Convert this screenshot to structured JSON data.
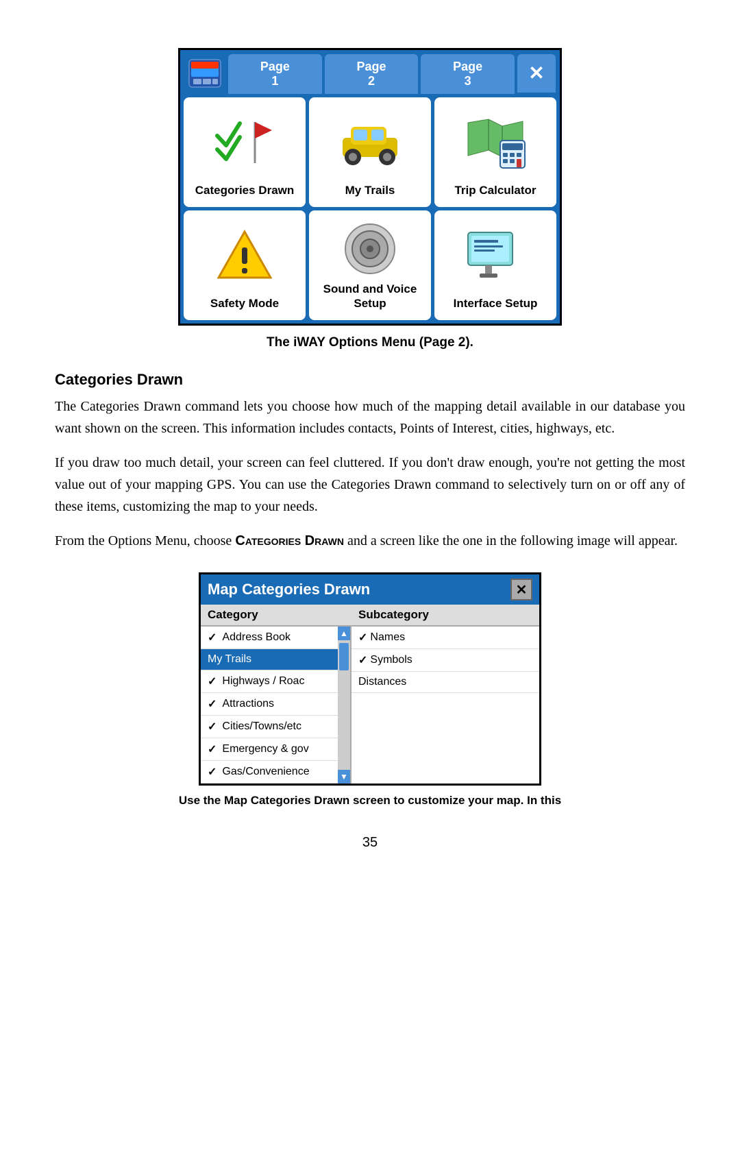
{
  "menu": {
    "tabs": [
      {
        "label": "Page\n1",
        "id": "page1"
      },
      {
        "label": "Page\n2",
        "id": "page2"
      },
      {
        "label": "Page\n3",
        "id": "page3"
      }
    ],
    "close_label": "✕",
    "cells": [
      {
        "id": "categories-drawn",
        "label": "Categories\nDrawn",
        "icon": "check-flag"
      },
      {
        "id": "my-trails",
        "label": "My Trails",
        "icon": "car"
      },
      {
        "id": "trip-calculator",
        "label": "Trip Calculator",
        "icon": "map-calc"
      },
      {
        "id": "safety-mode",
        "label": "Safety Mode",
        "icon": "warning"
      },
      {
        "id": "sound-voice",
        "label": "Sound and\nVoice Setup",
        "icon": "speaker"
      },
      {
        "id": "interface-setup",
        "label": "Interface Setup",
        "icon": "monitor"
      }
    ],
    "caption": "The iWAY Options Menu (Page 2)."
  },
  "section": {
    "heading": "Categories Drawn",
    "paragraphs": [
      "The Categories Drawn command lets you choose how much of the mapping detail available in our database you want shown on the screen. This information includes contacts, Points of Interest, cities, highways, etc.",
      "If you draw too much detail, your screen can feel cluttered. If you don't draw enough, you're not getting the most value out of your mapping GPS. You can use the Categories Drawn command to selectively turn on or off any of these items, customizing the map to your needs.",
      "From the Options Menu, choose CATEGORIES DRAWN and a screen like the one in the following image will appear."
    ]
  },
  "dialog": {
    "title": "Map Categories Drawn",
    "close": "✕",
    "col_category": "Category",
    "col_subcategory": "Subcategory",
    "categories": [
      {
        "label": "Address Book",
        "checked": true,
        "selected": false
      },
      {
        "label": "My Trails",
        "checked": false,
        "selected": true
      },
      {
        "label": "Highways / Roac",
        "checked": true,
        "selected": false
      },
      {
        "label": "Attractions",
        "checked": true,
        "selected": false
      },
      {
        "label": "Cities/Towns/etc",
        "checked": true,
        "selected": false
      },
      {
        "label": "Emergency & gov",
        "checked": true,
        "selected": false
      },
      {
        "label": "Gas/Convenience",
        "checked": true,
        "selected": false
      }
    ],
    "subcategories": [
      {
        "label": "Names",
        "checked": true
      },
      {
        "label": "Symbols",
        "checked": true
      },
      {
        "label": "Distances",
        "checked": false
      }
    ],
    "caption": "Use the Map Categories Drawn screen to customize your map. In this"
  },
  "page_number": "35"
}
